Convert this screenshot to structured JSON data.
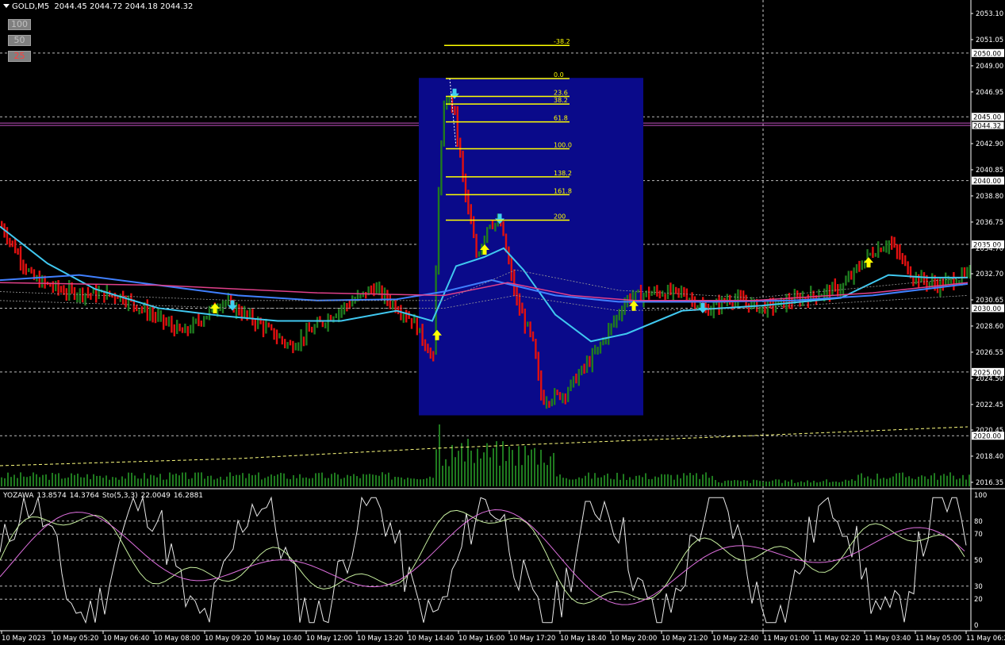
{
  "header": {
    "symbol": "GOLD,M5",
    "ohlc": "2044.45 2044.72 2044.18 2044.32"
  },
  "zoom_buttons": [
    {
      "label": "100",
      "active": false
    },
    {
      "label": "50",
      "active": false
    },
    {
      "label": "25",
      "active": true
    }
  ],
  "indicator": {
    "label": "YOZAWA",
    "v1": "13.8574",
    "v2": "14.3764",
    "sto_label": "Sto(5,3,3)",
    "sto1": "22.0049",
    "sto2": "16.2881"
  },
  "price_axis": {
    "ticks": [
      "2053.10",
      "2051.05",
      "2049.00",
      "2046.95",
      "2042.90",
      "2040.85",
      "2038.80",
      "2036.75",
      "2034.70",
      "2032.70",
      "2030.65",
      "2028.60",
      "2026.55",
      "2024.50",
      "2022.45",
      "2020.45",
      "2018.40",
      "2016.35"
    ],
    "highlight_labels": [
      "2050.00",
      "2045.00",
      "2040.00",
      "2035.00",
      "2030.00",
      "2025.00",
      "2020.00"
    ],
    "current_price": "2044.32"
  },
  "osc_axis": {
    "ticks": [
      "100",
      "80",
      "70",
      "50",
      "30",
      "20",
      "0"
    ]
  },
  "time_axis": {
    "labels": [
      "10 May 2023",
      "10 May 05:20",
      "10 May 06:40",
      "10 May 08:00",
      "10 May 09:20",
      "10 May 10:40",
      "10 May 12:00",
      "10 May 13:20",
      "10 May 14:40",
      "10 May 16:00",
      "10 May 17:20",
      "10 May 18:40",
      "10 May 20:00",
      "10 May 21:20",
      "10 May 22:40",
      "11 May 01:00",
      "11 May 02:20",
      "11 May 03:40",
      "11 May 05:00",
      "11 May 06:2"
    ]
  },
  "fibonacci": {
    "levels": [
      "-38.2",
      "0.0",
      "23.6",
      "38.2",
      "61.8",
      "100.0",
      "138.2",
      "161.8",
      "200"
    ]
  },
  "colors": {
    "bull": "#1f7a1f",
    "bear": "#e01010",
    "fib_box": "#0a0a8a",
    "fib_line": "#ffff00",
    "ma_fast": "#40c8f0",
    "ma_slow": "#4080ff",
    "ma_pink": "#e0408a",
    "current_line": "#c050c0"
  },
  "chart_data": {
    "type": "candlestick",
    "title": "GOLD,M5",
    "ylim": [
      2015.5,
      2054.5
    ],
    "x": [
      "10 May 2023",
      "10 May 05:20",
      "10 May 06:40",
      "10 May 08:00",
      "10 May 09:20",
      "10 May 10:40",
      "10 May 12:00",
      "10 May 13:20",
      "10 May 14:40",
      "10 May 16:00",
      "10 May 17:20",
      "10 May 18:40",
      "10 May 20:00",
      "10 May 21:20",
      "10 May 22:40",
      "11 May 01:00",
      "11 May 02:20",
      "11 May 03:40",
      "11 May 05:00",
      "11 May 06:2"
    ],
    "close_series": [
      2036.2,
      2031.8,
      2031.0,
      2028.5,
      2030.4,
      2027.2,
      2029.2,
      2031.0,
      2025.5,
      2046.0,
      2036.0,
      2023.5,
      2030.3,
      2031.6,
      2030.8,
      2030.5,
      2031.3,
      2034.5,
      2032.0,
      2032.8
    ],
    "current_price": 2044.32
  }
}
